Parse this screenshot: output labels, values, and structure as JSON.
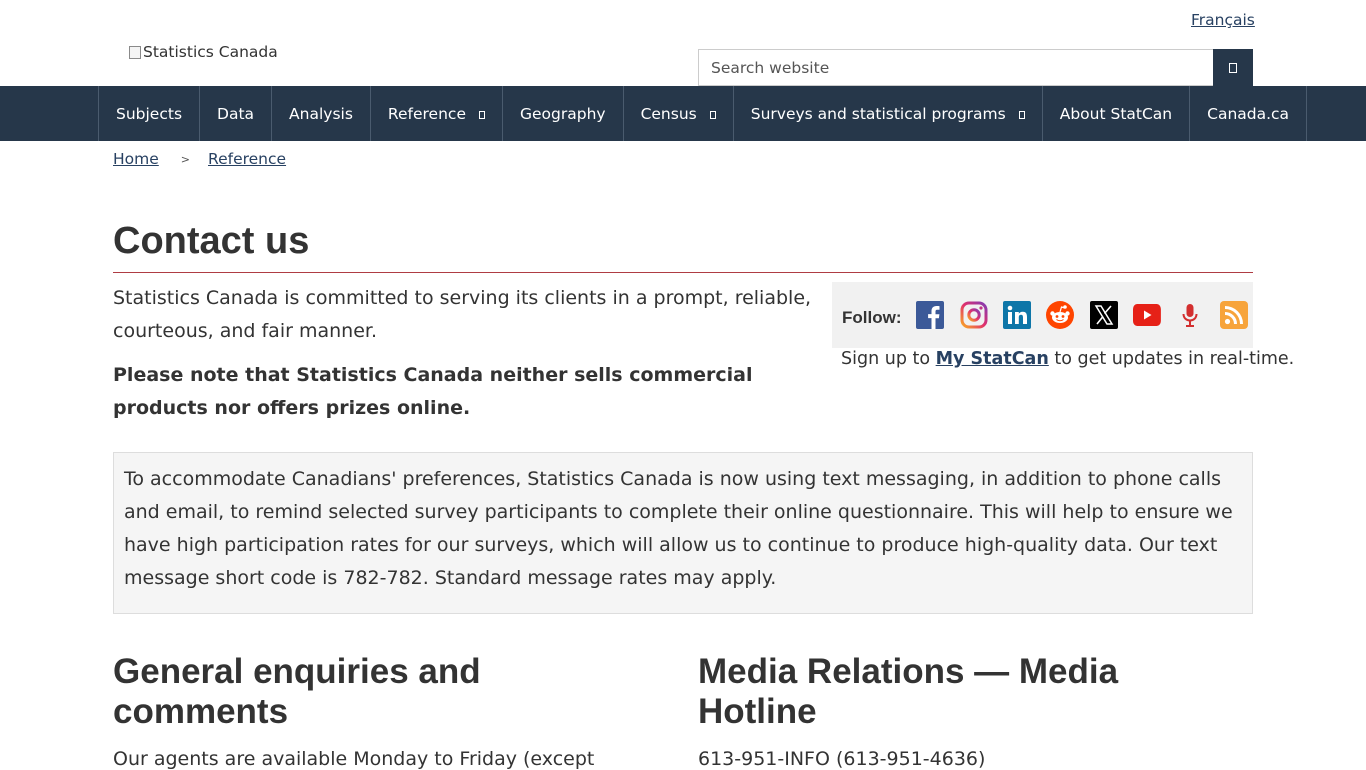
{
  "header": {
    "language_link": "Français",
    "logo_alt": "Statistics Canada",
    "search": {
      "placeholder": "Search website"
    }
  },
  "nav": {
    "items": [
      {
        "label": "Subjects",
        "has_menu": false
      },
      {
        "label": "Data",
        "has_menu": false
      },
      {
        "label": "Analysis",
        "has_menu": false
      },
      {
        "label": "Reference",
        "has_menu": true
      },
      {
        "label": "Geography",
        "has_menu": false
      },
      {
        "label": "Census",
        "has_menu": true
      },
      {
        "label": "Surveys and statistical programs",
        "has_menu": true
      },
      {
        "label": "About StatCan",
        "has_menu": false
      },
      {
        "label": "Canada.ca",
        "has_menu": false
      }
    ]
  },
  "breadcrumb": {
    "items": [
      "Home",
      "Reference"
    ],
    "separator": ">"
  },
  "page": {
    "title": "Contact us",
    "intro": "Statistics Canada is committed to serving its clients in a prompt, reliable, courteous, and fair manner.",
    "notice": "Please note that Statistics Canada neither sells commercial products nor offers prizes online."
  },
  "follow": {
    "label": "Follow:",
    "icons": [
      "facebook-icon",
      "instagram-icon",
      "linkedin-icon",
      "reddit-icon",
      "x-icon",
      "youtube-icon",
      "podcast-microphone-icon",
      "rss-icon"
    ],
    "signup_prefix": "Sign up to ",
    "signup_link": "My StatCan",
    "signup_suffix": " to get updates in real-time."
  },
  "info_box": {
    "text": "To accommodate Canadians' preferences, Statistics Canada is now using text messaging, in addition to phone calls and email, to remind selected survey participants to complete their online questionnaire. This will help to ensure we have high participation rates for our surveys, which will allow us to continue to produce high-quality data. Our text message short code is 782-782. Standard message rates may apply."
  },
  "sections": {
    "general": {
      "heading": "General enquiries and comments",
      "text": "Our agents are available Monday to Friday (except"
    },
    "media": {
      "heading": "Media Relations — Media Hotline",
      "text": "613-951-INFO (613-951-4636)"
    }
  },
  "colors": {
    "nav_bg": "#26374a",
    "link": "#284162",
    "title_rule": "#af3c43",
    "panel_bg": "#f1f1f1"
  }
}
